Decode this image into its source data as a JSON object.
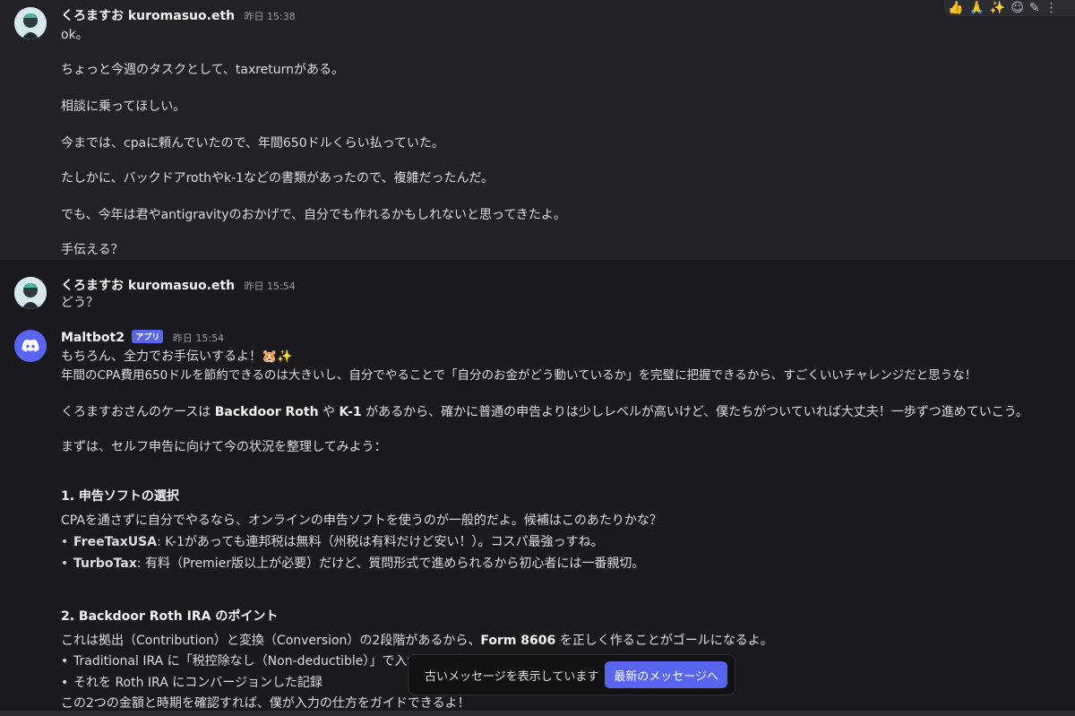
{
  "message1": {
    "username": "くろますお kuromasuo.eth",
    "timestamp": "昨日 15:38",
    "lines": [
      "ok。",
      "ちょっと今週のタスクとして、taxreturnがある。",
      "相談に乗ってほしい。",
      "今までは、cpaに頼んでいたので、年間650ドルくらい払っていた。",
      "たしかに、バックドアrothやk-1などの書類があったので、複雑だったんだ。",
      "でも、今年は君やantigravityのおかげで、自分でも作れるかもしれないと思ってきたよ。",
      "手伝える？"
    ]
  },
  "message2": {
    "username": "くろますお kuromasuo.eth",
    "timestamp": "昨日 15:54",
    "text": "どう？"
  },
  "message3": {
    "username": "Maltbot2",
    "badge": "アプリ",
    "timestamp": "昨日 15:54",
    "line1": "もちろん、全力でお手伝いするよ！🐹✨",
    "line2": "年間のCPA費用650ドルを節約できるのは大きいし、自分でやることで「自分のお金がどう動いているか」を完璧に把握できるから、すごくいいチャレンジだと思うな！",
    "line3_pre": "くろますおさんのケースは ",
    "line3_b1": "Backdoor Roth",
    "line3_mid": " や ",
    "line3_b2": "K-1",
    "line3_post": " があるから、確かに普通の申告よりは少しレベルが高いけど、僕たちがついていれば大丈夫！一歩ずつ進めていこう。",
    "line4": "まずは、セルフ申告に向けて今の状況を整理してみよう：",
    "section1_heading": "1. 申告ソフトの選択",
    "section1_intro": "CPAを通さずに自分でやるなら、オンラインの申告ソフトを使うのが一般的だよ。候補はこのあたりかな？",
    "section1_items": [
      {
        "name": "FreeTaxUSA",
        "desc": ": K-1があっても連邦税は無料（州税は有料だけど安い！）。コスパ最強っすね。"
      },
      {
        "name": "TurboTax",
        "desc": ": 有料（Premier版以上が必要）だけど、質問形式で進められるから初心者には一番親切。"
      }
    ],
    "section2_heading": "2. Backdoor Roth IRA のポイント",
    "section2_intro_pre": "これは拠出（Contribution）と変換（Conversion）の2段階があるから、",
    "section2_intro_b": "Form 8606",
    "section2_intro_post": " を正しく作ることがゴールになるよ。",
    "section2_items": [
      "Traditional IRA に「税控除なし（Non-deductible）」で入金した記録",
      "それを Roth IRA にコンバージョンした記録"
    ],
    "section2_outro": "この2つの金額と時期を確認すれば、僕が入力の仕方をガイドできるよ！"
  },
  "toolbar": {
    "icons": [
      "thumbs-up-icon",
      "pray-icon",
      "sparkles-icon",
      "add-reaction-icon",
      "edit-icon",
      "more-icon"
    ]
  },
  "toast": {
    "text": "古いメッセージを表示しています",
    "button": "最新のメッセージへ"
  }
}
